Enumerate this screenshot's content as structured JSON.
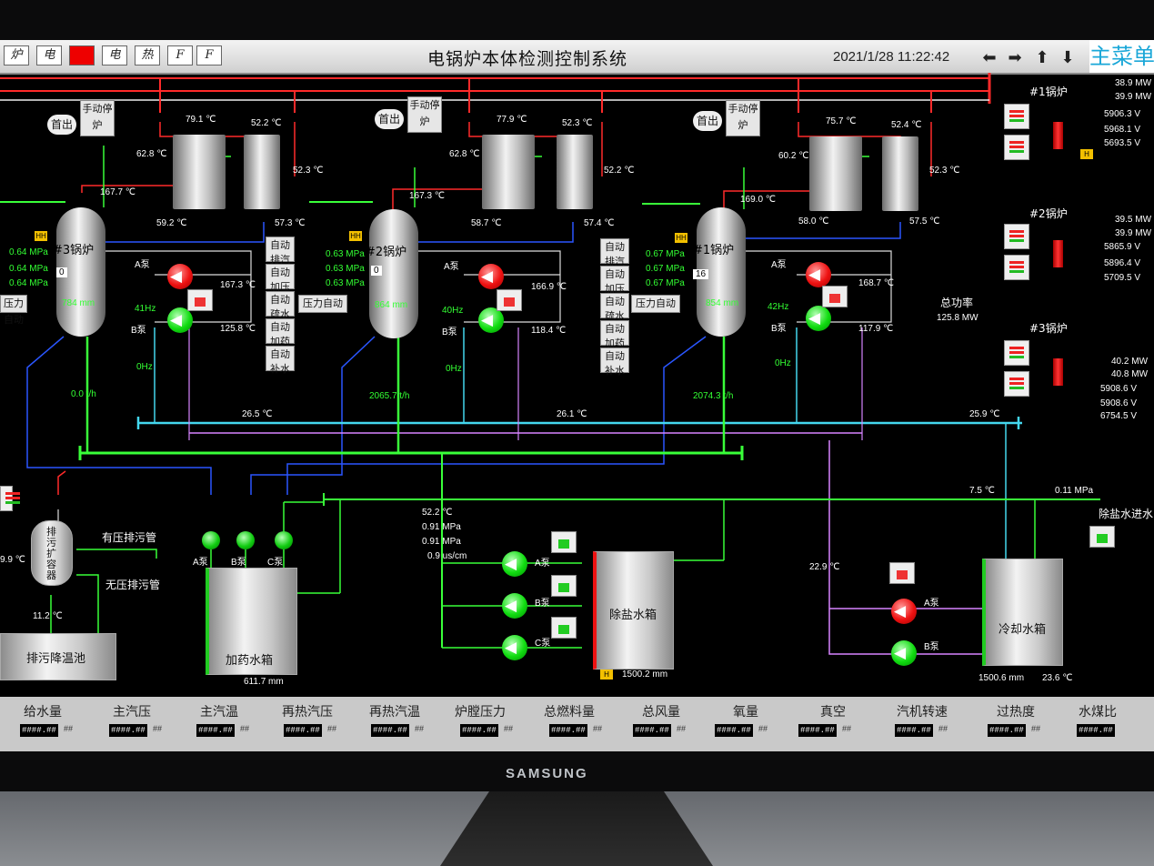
{
  "titlebar": {
    "buttons": [
      "炉",
      "电",
      "",
      "电",
      "热",
      "F",
      "F"
    ],
    "title": "电锅炉本体检测控制系统",
    "datetime": "2021/1/28 11:22:42",
    "main_menu": "主菜单"
  },
  "boilers": {
    "b3": {
      "name": "#3锅炉",
      "t_top_left": "79.1 ℃",
      "t_top_right": "52.2 ℃",
      "t_left": "62.8 ℃",
      "t_right": "52.3 ℃",
      "t_mid": "167.7 ℃",
      "t_low_left": "59.2 ℃",
      "t_low_right": "57.3 ℃",
      "p1": "0.64 MPa",
      "p2": "0.64 MPa",
      "p3": "0.64 MPa",
      "level": "784 mm",
      "box": "0",
      "freq_a": "41Hz",
      "freq_b": "0Hz",
      "t_ret_a": "167.3 ℃",
      "t_ret_b": "125.8 ℃",
      "flow": "0.0 t/h"
    },
    "b2": {
      "name": "#2锅炉",
      "t_top_left": "77.9 ℃",
      "t_top_right": "52.3 ℃",
      "t_left": "62.8 ℃",
      "t_right": "52.2 ℃",
      "t_mid": "167.3 ℃",
      "t_low_left": "58.7 ℃",
      "t_low_right": "57.4 ℃",
      "p1": "0.63 MPa",
      "p2": "0.63 MPa",
      "p3": "0.63 MPa",
      "level": "864 mm",
      "box": "0",
      "freq_a": "40Hz",
      "freq_b": "0Hz",
      "t_ret_a": "166.9 ℃",
      "t_ret_b": "118.4 ℃",
      "flow": "2065.7 t/h"
    },
    "b1": {
      "name": "#1锅炉",
      "t_top_left": "75.7 ℃",
      "t_top_right": "52.4 ℃",
      "t_left": "60.2 ℃",
      "t_right": "52.3 ℃",
      "t_mid": "169.0 ℃",
      "t_low_left": "58.0 ℃",
      "t_low_right": "57.5 ℃",
      "p1": "0.67 MPa",
      "p2": "0.67 MPa",
      "p3": "0.67 MPa",
      "level": "854 mm",
      "box": "16",
      "freq_a": "42Hz",
      "freq_b": "0Hz",
      "t_ret_a": "168.7 ℃",
      "t_ret_b": "117.9 ℃",
      "flow": "2074.3 t/h"
    }
  },
  "common": {
    "btn_first_out": "首出",
    "btn_manual_stop": "手动停炉",
    "btn_pressure_auto": "压力自动",
    "auto_buttons": [
      "自动排汽",
      "自动加压",
      "自动疏水",
      "自动加药",
      "自动补水"
    ],
    "pump_a": "A泵",
    "pump_b": "B泵",
    "pump_c": "C泵",
    "hh": "HH",
    "h": "H"
  },
  "header_temps": {
    "t1": "26.5 ℃",
    "t2": "26.1 ℃",
    "t3": "25.9 ℃"
  },
  "lower": {
    "sewage_exp_vessel": "排污扩容器",
    "sewage_exp_temp": "9.9 ℃",
    "sewage_out_temp": "11.2 ℃",
    "pressurized_drain": "有压排污管",
    "unpressurized_drain": "无压排污管",
    "cooling_pool": "排污降温池",
    "dosing_tank": "加药水箱",
    "dosing_level": "611.7 mm",
    "demin_tank": "除盐水箱",
    "demin_level": "1500.2 mm",
    "demin_temp": "52.2 ℃",
    "demin_p1": "0.91 MPa",
    "demin_p2": "0.91 MPa",
    "demin_cond": "0.9 us/cm",
    "cooling_tank": "冷却水箱",
    "cooling_level": "1500.6 mm",
    "cooling_temp": "23.6 ℃",
    "line_temp": "7.5 ℃",
    "inlet_pressure": "0.11 MPa",
    "demin_inlet": "除盐水进水",
    "cool_pipe_temp": "22.9 ℃"
  },
  "right_panel": {
    "b1_label": "#1锅炉",
    "b2_label": "#2锅炉",
    "b3_label": "#3锅炉",
    "b1_vals": [
      "38.9 MW",
      "39.9 MW",
      "5906.3 V",
      "5968.1 V",
      "5693.5 V"
    ],
    "b2_vals": [
      "39.5 MW",
      "39.9 MW",
      "5865.9 V",
      "5896.4 V",
      "5709.5 V"
    ],
    "b3_vals": [
      "40.2 MW",
      "40.8 MW",
      "5908.6 V",
      "5908.6 V",
      "6754.5 V"
    ],
    "total_power_label": "总功率",
    "total_power": "125.8 MW"
  },
  "status_bar": {
    "labels": [
      "给水量",
      "主汽压",
      "主汽温",
      "再热汽压",
      "再热汽温",
      "炉膛压力",
      "总燃料量",
      "总风量",
      "氧量",
      "真空",
      "汽机转速",
      "过热度",
      "水煤比"
    ],
    "value": "####.##",
    "unit": "##"
  },
  "monitor_brand": "SAMSUNG",
  "colors": {
    "steam_red": "#ff2a2a",
    "water_green": "#39ff39",
    "blue_pipe": "#2a56ff",
    "cyan_pipe": "#44d7ee",
    "violet_pipe": "#d784ff",
    "alarm_yellow": "#f3c000"
  }
}
